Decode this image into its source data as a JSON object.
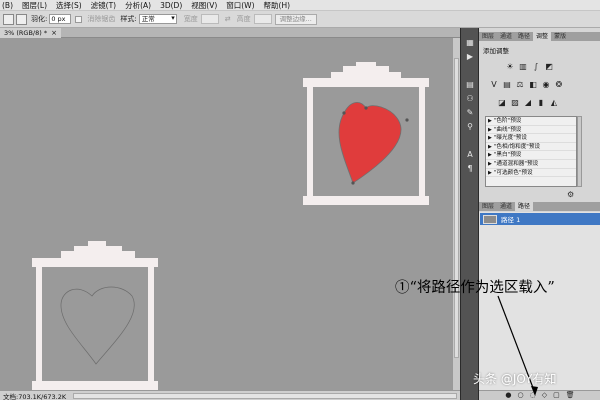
{
  "menubar": {
    "items": [
      "(B)",
      "图层(L)",
      "选择(S)",
      "滤镜(T)",
      "分析(A)",
      "3D(D)",
      "视图(V)",
      "窗口(W)",
      "帮助(H)"
    ]
  },
  "options": {
    "feather_label": "羽化:",
    "feather_value": "0 px",
    "antialias_label": "消除锯齿",
    "style_label": "样式:",
    "style_value": "正常",
    "width_label": "宽度",
    "height_label": "高度",
    "refine_button": "调整边缘..."
  },
  "document": {
    "tab_label": "3% (RGB/8) *",
    "close_glyph": "×"
  },
  "status": {
    "doc_info": "文档:703.1K/673.2K"
  },
  "colors": {
    "canvas": "#9a9a9a",
    "frame": "#f4eeee",
    "heart_fill": "#e03c3c",
    "heart_outline": "#707070",
    "selected_path": "#3f78c4"
  },
  "panel": {
    "top_tabs": [
      "图层",
      "通道",
      "路径",
      "调整",
      "蒙版"
    ],
    "active_top_tab": "调整",
    "adjust_title": "添加调整",
    "adjust_icons_row1": [
      "brightness-contrast-icon",
      "levels-icon",
      "curves-icon",
      "exposure-icon"
    ],
    "adjust_icons_row2": [
      "vibrance-icon",
      "hue-saturation-icon",
      "color-balance-icon",
      "black-white-icon",
      "photo-filter-icon",
      "channel-mixer-icon"
    ],
    "adjust_icons_row3": [
      "invert-icon",
      "posterize-icon",
      "threshold-icon",
      "gradient-map-icon",
      "selective-color-icon"
    ],
    "presets": [
      "\"色阶\"预设",
      "\"曲线\"预设",
      "\"曝光度\"预设",
      "\"色相/饱和度\"预设",
      "\"黑白\"预设",
      "\"通道混和器\"预设",
      "\"可选颜色\"预设"
    ],
    "bottom_tabs": [
      "图层",
      "通道",
      "路径"
    ],
    "active_bottom_tab": "路径",
    "path_item": "路径 1",
    "path_buttons": [
      "fill-path-icon",
      "stroke-path-icon",
      "load-path-as-selection-icon",
      "make-work-path-icon",
      "new-path-icon",
      "delete-path-icon"
    ]
  },
  "annotation": {
    "text": "①“将路径作为选区载入”"
  },
  "watermark": {
    "text": "头条 @JOY有知"
  }
}
